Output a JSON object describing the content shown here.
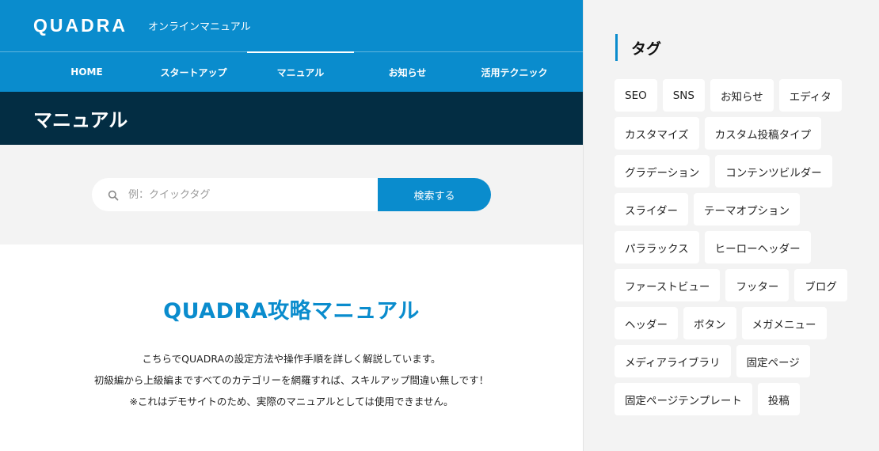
{
  "header": {
    "logo": "QUADRA",
    "subtitle": "オンラインマニュアル"
  },
  "nav": {
    "items": [
      {
        "label": "HOME"
      },
      {
        "label": "スタートアップ"
      },
      {
        "label": "マニュアル"
      },
      {
        "label": "お知らせ"
      },
      {
        "label": "活用テクニック"
      }
    ]
  },
  "page": {
    "title": "マニュアル"
  },
  "search": {
    "placeholder": "例：クイックタグ",
    "button_label": "検索する"
  },
  "content": {
    "heading": "QUADRA攻略マニュアル",
    "lines": [
      "こちらでQUADRAの設定方法や操作手順を詳しく解説しています。",
      "初級編から上級編まですべてのカテゴリーを網羅すれば、スキルアップ間違い無しです！",
      "※これはデモサイトのため、実際のマニュアルとしては使用できません。"
    ]
  },
  "sidebar": {
    "title": "タグ",
    "tags": [
      "SEO",
      "SNS",
      "お知らせ",
      "エディタ",
      "カスタマイズ",
      "カスタム投稿タイプ",
      "グラデーション",
      "コンテンツビルダー",
      "スライダー",
      "テーマオプション",
      "パララックス",
      "ヒーローヘッダー",
      "ファーストビュー",
      "フッター",
      "ブログ",
      "ヘッダー",
      "ボタン",
      "メガメニュー",
      "メディアライブラリ",
      "固定ページ",
      "固定ページテンプレート",
      "投稿"
    ]
  },
  "colors": {
    "brand": "#0a8ccd",
    "dark": "#032d43",
    "light_bg": "#f3f3f3"
  },
  "icons": {
    "search": "search-icon"
  }
}
